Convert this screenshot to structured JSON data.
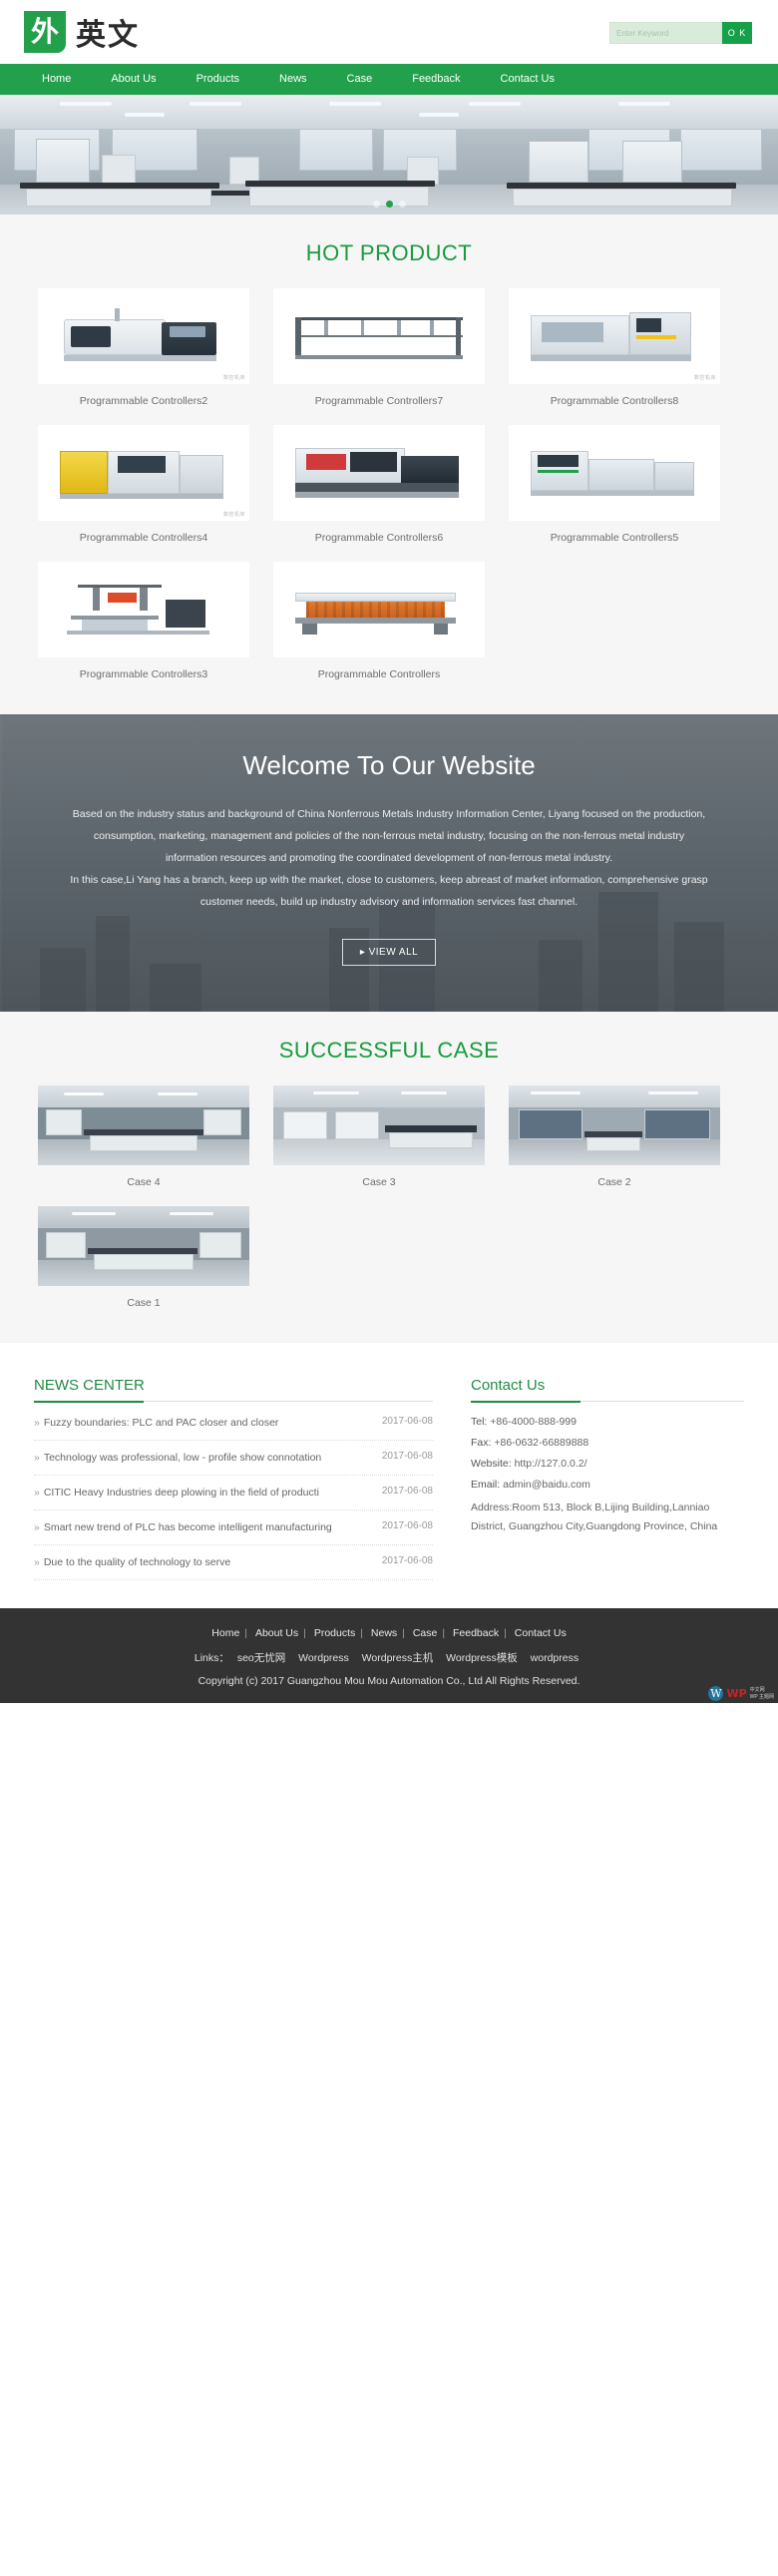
{
  "header": {
    "logo_mark": "外",
    "logo_text": "英文",
    "search": {
      "placeholder": "Enter Keyword",
      "value": "",
      "button_label": "O K"
    }
  },
  "nav": {
    "items": [
      {
        "label": "Home"
      },
      {
        "label": "About Us"
      },
      {
        "label": "Products"
      },
      {
        "label": "News"
      },
      {
        "label": "Case"
      },
      {
        "label": "Feedback"
      },
      {
        "label": "Contact Us"
      }
    ]
  },
  "banner": {
    "slides": 3,
    "active_index": 1
  },
  "hot_product": {
    "title": "HOT PRODUCT",
    "items": [
      {
        "label": "Programmable Controllers2",
        "watermark": "数控机床"
      },
      {
        "label": "Programmable Controllers7",
        "watermark": ""
      },
      {
        "label": "Programmable Controllers8",
        "watermark": "数控机床"
      },
      {
        "label": "Programmable Controllers4",
        "watermark": "数控机床"
      },
      {
        "label": "Programmable Controllers6",
        "watermark": ""
      },
      {
        "label": "Programmable Controllers5",
        "watermark": ""
      },
      {
        "label": "Programmable Controllers3",
        "watermark": ""
      },
      {
        "label": "Programmable Controllers",
        "watermark": ""
      }
    ]
  },
  "welcome": {
    "title": "Welcome To Our Website",
    "paragraph1": "Based on the industry status and background of China Nonferrous Metals Industry Information Center, Liyang focused on the production, consumption, marketing, management and policies of the non-ferrous metal industry, focusing on the non-ferrous metal industry information resources and promoting the coordinated development of non-ferrous metal industry.",
    "paragraph2": "In this case,Li Yang has a branch, keep up with the market, close to customers, keep abreast of market information, comprehensive grasp customer needs, build up industry advisory and information services fast channel.",
    "view_all_label": "▸ VIEW ALL"
  },
  "successful_case": {
    "title": "SUCCESSFUL CASE",
    "items": [
      {
        "label": "Case 4"
      },
      {
        "label": "Case 3"
      },
      {
        "label": "Case 2"
      },
      {
        "label": "Case 1"
      }
    ]
  },
  "news_center": {
    "title": "NEWS CENTER",
    "items": [
      {
        "title": "Fuzzy boundaries: PLC and PAC closer and closer",
        "date": "2017-06-08"
      },
      {
        "title": "Technology was professional, low - profile show connotation",
        "date": "2017-06-08"
      },
      {
        "title": "CITIC Heavy Industries deep plowing in the field of producti",
        "date": "2017-06-08"
      },
      {
        "title": "Smart new trend of PLC has become intelligent manufacturing",
        "date": "2017-06-08"
      },
      {
        "title": "Due to the quality of technology to serve",
        "date": "2017-06-08"
      }
    ]
  },
  "contact": {
    "title": "Contact Us",
    "tel_label": "Tel:",
    "tel_value": "+86-4000-888-999",
    "fax_label": "Fax:",
    "fax_value": "+86-0632-66889888",
    "website_label": "Website:",
    "website_value": "http://127.0.0.2/",
    "email_label": "Email:",
    "email_value": "admin@baidu.com",
    "address": "Address:Room 513, Block B,Lijing Building,Lanniao District, Guangzhou City,Guangdong Province, China"
  },
  "footer": {
    "nav": [
      "Home",
      "About Us",
      "Products",
      "News",
      "Case",
      "Feedback",
      "Contact Us"
    ],
    "links_label": "Links：",
    "links": [
      "seo无忧网",
      "Wordpress",
      "Wordpress主机",
      "Wordpress模板",
      "wordpress"
    ],
    "copyright": "Copyright (c) 2017 Guangzhou Mou Mou Automation Co., Ltd All Rights Reserved.",
    "badge_mark": "W",
    "badge_text": "WP",
    "badge_sub_1": "中文网",
    "badge_sub_2": "WP 主题网"
  },
  "colors": {
    "brand_green": "#22a04b",
    "title_green": "#199b3f",
    "footer_dark": "#333333",
    "section_bg": "#f6f6f6"
  }
}
